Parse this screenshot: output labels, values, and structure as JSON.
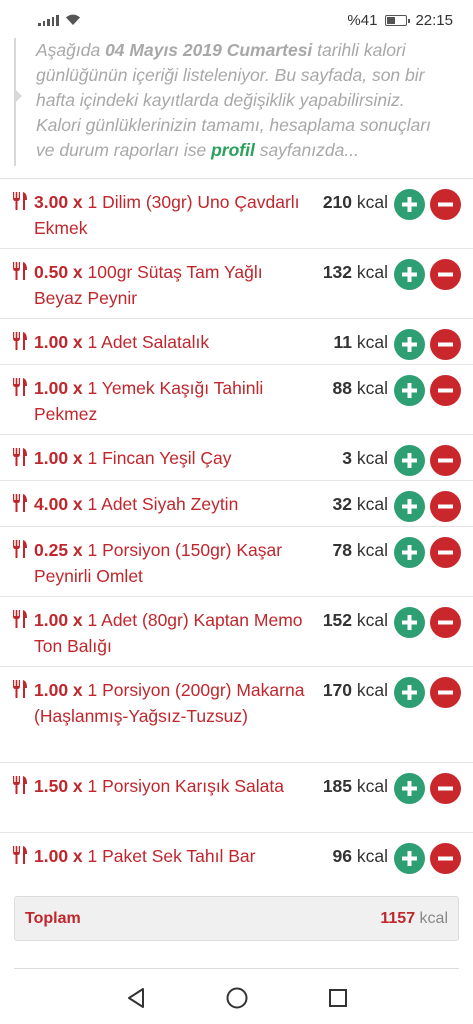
{
  "status": {
    "battery_percent": "%41",
    "battery_level": 0.41,
    "time": "22:15"
  },
  "description": {
    "part1": "Aşağıda ",
    "date": "04 Mayıs 2019 Cumartesi",
    "part2": " tarihli kalori günlüğünün içeriği listeleniyor. Bu sayfada, son bir hafta içindeki kayıtlarda değişiklik yapabilirsiniz. Kalori günlüklerinizin tamamı, hesaplama sonuçları ve durum raporları ise ",
    "profile_link": "profil",
    "part3": " sayfanızda..."
  },
  "foods": [
    {
      "qty": "3.00 x",
      "name": " 1 Dilim (30gr) Uno Çavdarlı Ekmek",
      "kcal": "210",
      "unit": " kcal"
    },
    {
      "qty": "0.50 x",
      "name": " 100gr Sütaş Tam Yağlı Beyaz Peynir",
      "kcal": "132",
      "unit": " kcal"
    },
    {
      "qty": "1.00 x",
      "name": " 1 Adet Salatalık",
      "kcal": "11",
      "unit": " kcal"
    },
    {
      "qty": "1.00 x",
      "name": " 1 Yemek Kaşığı Tahinli Pekmez",
      "kcal": "88",
      "unit": " kcal"
    },
    {
      "qty": "1.00 x",
      "name": " 1 Fincan Yeşil Çay",
      "kcal": "3",
      "unit": " kcal"
    },
    {
      "qty": "4.00 x",
      "name": " 1 Adet Siyah Zeytin",
      "kcal": "32",
      "unit": " kcal"
    },
    {
      "qty": "0.25 x",
      "name": " 1 Porsiyon (150gr) Kaşar Peynirli Omlet",
      "kcal": "78",
      "unit": " kcal"
    },
    {
      "qty": "1.00 x",
      "name": " 1 Adet (80gr) Kaptan Memo Ton Balığı",
      "kcal": "152",
      "unit": " kcal"
    },
    {
      "qty": "1.00 x",
      "name": " 1 Porsiyon (200gr) Makarna (Haşlanmış-Yağsız-Tuzsuz)",
      "kcal": "170",
      "unit": " kcal"
    },
    {
      "qty": "1.50 x",
      "name": " 1 Porsiyon Karışık Salata",
      "kcal": "185",
      "unit": " kcal"
    },
    {
      "qty": "1.00 x",
      "name": " 1 Paket Sek Tahıl Bar",
      "kcal": "96",
      "unit": " kcal"
    }
  ],
  "total": {
    "label": "Toplam",
    "value": "1157",
    "unit": " kcal"
  },
  "colors": {
    "accent_red": "#c0272d",
    "plus_green": "#2e9e73",
    "minus_red": "#c9272c",
    "link_green": "#2aa05a"
  },
  "icons": {
    "food": "fork-knife-icon",
    "add": "plus-circle-icon",
    "remove": "minus-circle-icon",
    "nav_back": "triangle-back-icon",
    "nav_home": "circle-home-icon",
    "nav_recent": "square-recent-icon"
  }
}
